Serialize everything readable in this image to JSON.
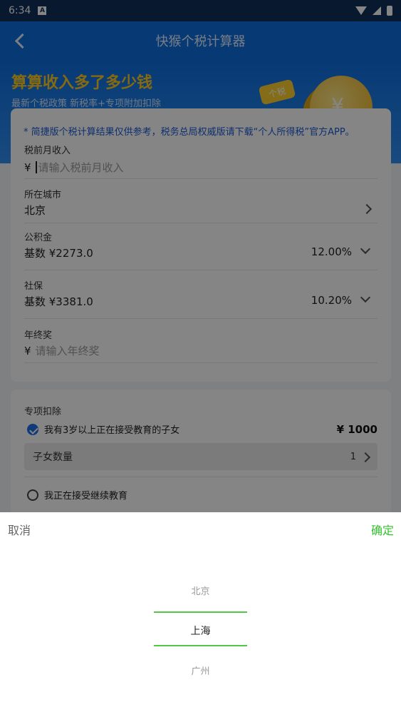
{
  "status_bar": {
    "time": "6:34",
    "notif": "A"
  },
  "app_bar": {
    "title": "快猴个税计算器"
  },
  "hero": {
    "headline": "算算收入多了多少钱",
    "subline": "最新个税政策 新税率+专项附加扣除",
    "tag": "个税",
    "coin_symbol": "¥"
  },
  "form": {
    "notice": "* 简捷版个税计算结果仅供参考，税务总局权威版请下载“个人所得税”官方APP。",
    "currency": "¥",
    "income": {
      "label": "税前月收入",
      "placeholder": "请输入税前月收入"
    },
    "city": {
      "label": "所在城市",
      "value": "北京"
    },
    "housing_fund": {
      "label": "公积金",
      "base": "基数 ¥2273.0",
      "rate": "12.00%"
    },
    "social_security": {
      "label": "社保",
      "base": "基数 ¥3381.0",
      "rate": "10.20%"
    },
    "bonus": {
      "label": "年终奖",
      "placeholder": "请输入年终奖"
    }
  },
  "deductions": {
    "title": "专项扣除",
    "children_education": {
      "label": "我有3岁以上正在接受教育的子女",
      "amount": "¥ 1000",
      "checked": true
    },
    "children_count": {
      "label": "子女数量",
      "value": "1"
    },
    "continuing_education": {
      "label": "我正在接受继续教育",
      "checked": false
    }
  },
  "picker": {
    "cancel": "取消",
    "confirm": "确定",
    "options": [
      "北京",
      "上海",
      "广州"
    ],
    "selected_index": 1,
    "accent_color": "#52c748"
  }
}
